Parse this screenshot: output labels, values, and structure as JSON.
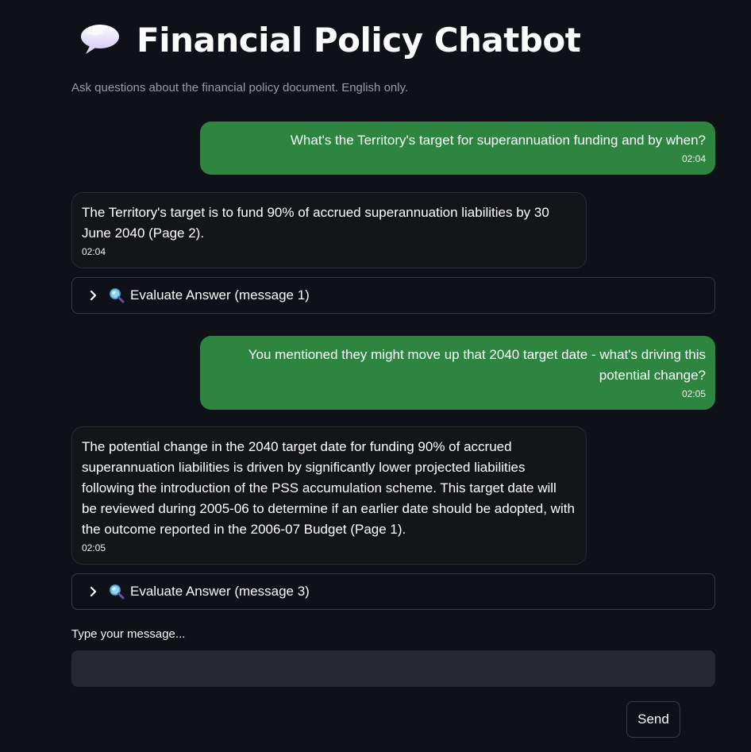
{
  "app": {
    "title": "Financial Policy Chatbot",
    "title_icon": "speech-balloon-icon",
    "subtitle": "Ask questions about the financial policy document. English only."
  },
  "chat": {
    "messages": [
      {
        "role": "user",
        "text": "What's the Territory's target for superannuation funding and by when?",
        "time": "02:04"
      },
      {
        "role": "assistant",
        "text": "The Territory's target is to fund 90% of accrued superannuation liabilities by 30 June 2040 (Page 2).",
        "time": "02:04"
      },
      {
        "role": "user",
        "text": "You mentioned they might move up that 2040 target date - what's driving this potential change?",
        "time": "02:05"
      },
      {
        "role": "assistant",
        "text": "The potential change in the 2040 target date for funding 90% of accrued superannuation liabilities is driven by significantly lower projected liabilities following the introduction of the PSS accumulation scheme. This target date will be reviewed during 2005-06 to determine if an earlier date should be adopted, with the outcome reported in the 2006-07 Budget (Page 1).",
        "time": "02:05"
      }
    ],
    "evaluations": [
      {
        "label": "Evaluate Answer (message 1)",
        "icon": "magnifying-glass-icon",
        "expanded": false
      },
      {
        "label": "Evaluate Answer (message 3)",
        "icon": "magnifying-glass-icon",
        "expanded": false
      }
    ]
  },
  "input": {
    "label": "Type your message...",
    "value": "",
    "placeholder": ""
  },
  "send_button": {
    "label": "Send"
  },
  "colors": {
    "background": "#0e1117",
    "user_bubble": "#2e8540",
    "assistant_bubble": "#141518",
    "input_background": "#262730",
    "border": "#3a3d46"
  }
}
